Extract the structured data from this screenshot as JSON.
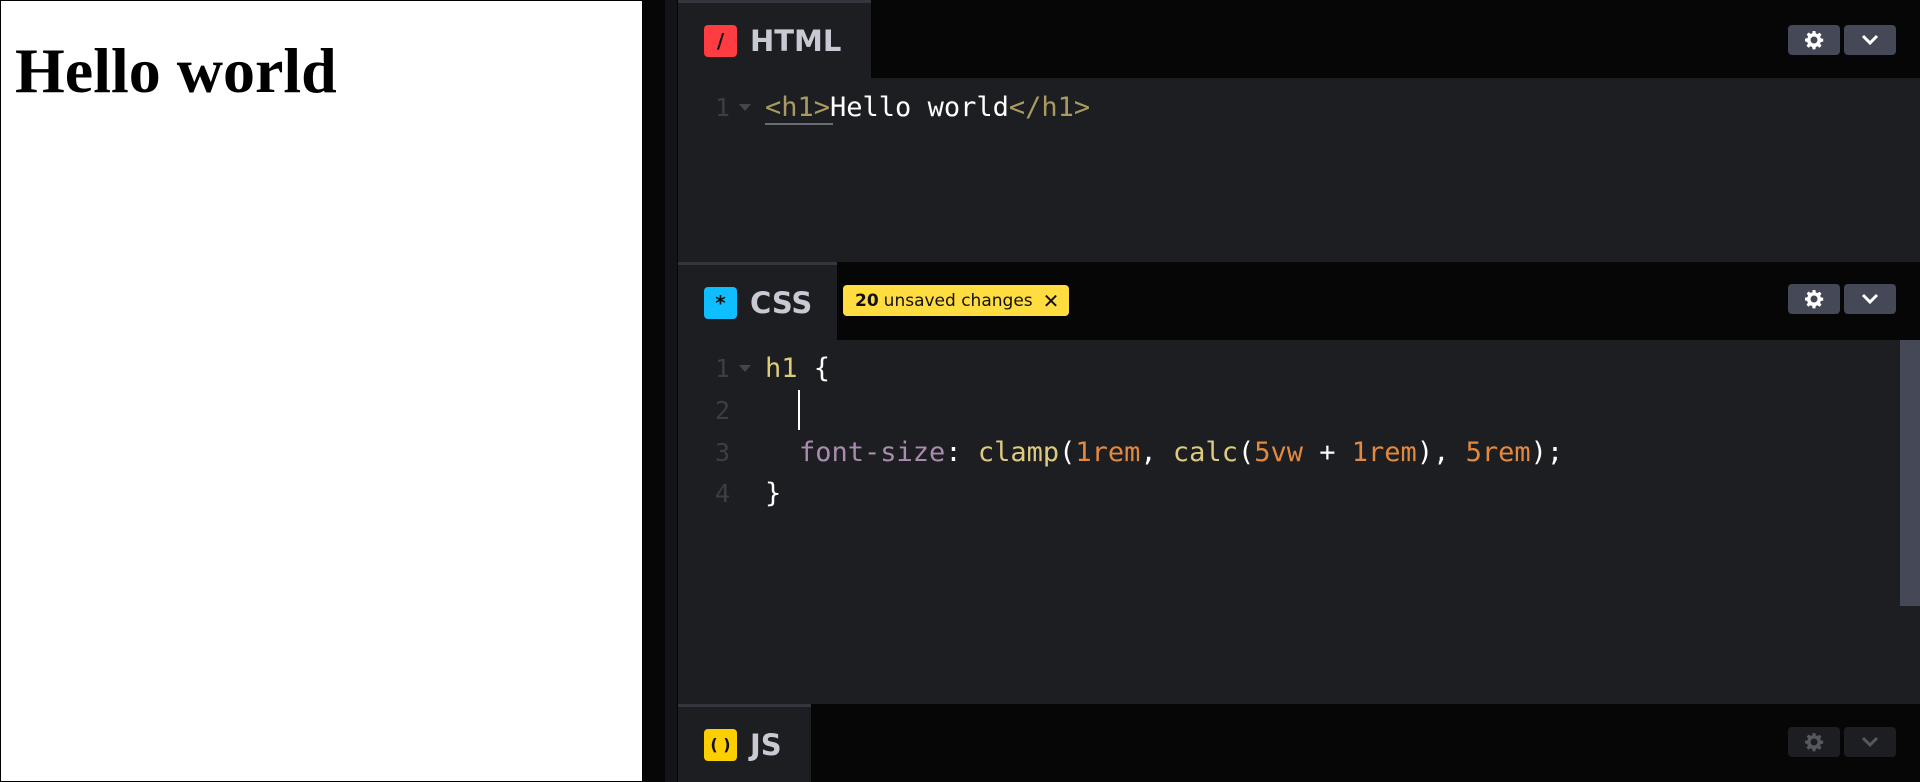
{
  "preview": {
    "heading": "Hello world"
  },
  "html_panel": {
    "label": "HTML",
    "badge_glyph": "/",
    "badge_color": "#ff3c41",
    "lines": [
      {
        "num": "1",
        "open": "<h1>",
        "text": "Hello world",
        "close": "</h1>"
      }
    ]
  },
  "css_panel": {
    "label": "CSS",
    "badge_glyph": "*",
    "badge_color": "#0ebeff",
    "unsaved_count": "20",
    "unsaved_text": "unsaved changes",
    "lines": [
      {
        "num": "1",
        "selector": "h1",
        "brace": " {"
      },
      {
        "num": "2"
      },
      {
        "num": "3",
        "prop": "font-size",
        "colon": ": ",
        "fn1": "clamp",
        "p1": "(",
        "v1": "1rem",
        "c1": ", ",
        "fn2": "calc",
        "p2": "(",
        "v2": "5vw",
        "op": " + ",
        "v3": "1rem",
        "p3": "), ",
        "v4": "5rem",
        "end": ");"
      },
      {
        "num": "4",
        "brace": "}"
      }
    ]
  },
  "js_panel": {
    "label": "JS",
    "badge_glyph": "( )",
    "badge_color": "#fcd000"
  },
  "icons": {
    "settings": "gear-icon",
    "collapse": "chevron-down-icon",
    "close": "close-icon"
  }
}
